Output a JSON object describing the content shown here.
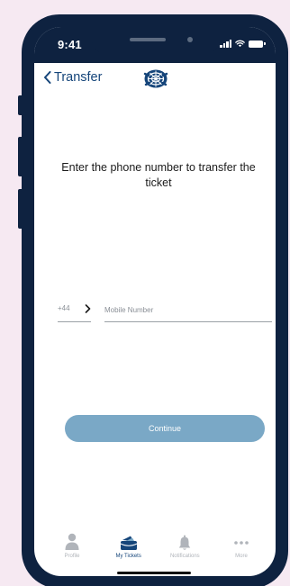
{
  "status": {
    "time": "9:41"
  },
  "nav": {
    "back_label": "Transfer"
  },
  "content": {
    "heading": "Enter the phone number to transfer the ticket"
  },
  "phone_input": {
    "country_code": "+44",
    "placeholder": "Mobile Number"
  },
  "continue_button": {
    "label": "Continue"
  },
  "tabs": [
    {
      "label": "Profile",
      "icon": "person-icon",
      "active": false
    },
    {
      "label": "My Tickets",
      "icon": "ticket-wallet-icon",
      "active": true
    },
    {
      "label": "Notifications",
      "icon": "bell-icon",
      "active": false
    },
    {
      "label": "More",
      "icon": "more-dots-icon",
      "active": false
    }
  ],
  "colors": {
    "navy": "#0e2240",
    "accent": "#15457a",
    "button": "#7aa8c6",
    "background": "#f6e9f2",
    "inactive_tab": "#b0b4ba"
  }
}
